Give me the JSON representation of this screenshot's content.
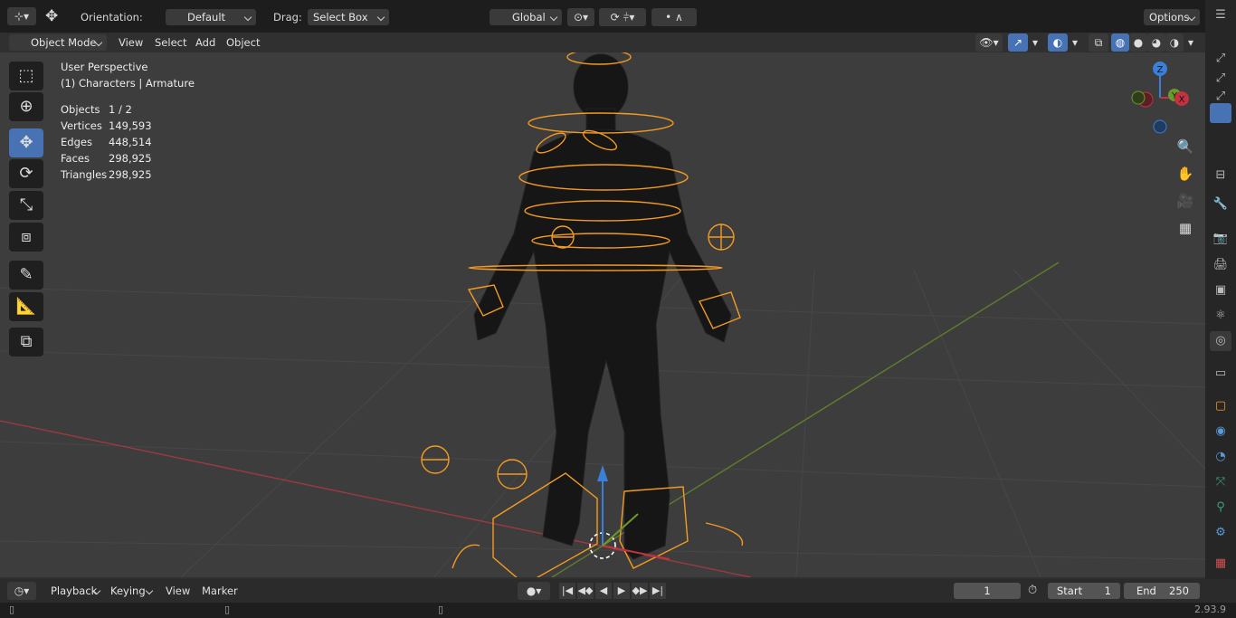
{
  "tool_header": {
    "orientation_label": "Orientation:",
    "orientation_value": "Default",
    "drag_label": "Drag:",
    "drag_value": "Select Box",
    "transform_orientation": "Global",
    "options_label": "Options"
  },
  "viewport_header": {
    "mode": "Object Mode",
    "menus": [
      "View",
      "Select",
      "Add",
      "Object"
    ]
  },
  "overlay": {
    "perspective": "User Perspective",
    "collection": "(1) Characters | Armature",
    "stats": [
      {
        "label": "Objects",
        "value": "1 / 2"
      },
      {
        "label": "Vertices",
        "value": "149,593"
      },
      {
        "label": "Edges",
        "value": "448,514"
      },
      {
        "label": "Faces",
        "value": "298,925"
      },
      {
        "label": "Triangles",
        "value": "298,925"
      }
    ]
  },
  "gizmo": {
    "z_label": "Z",
    "y_label": "Y",
    "x_label": "X"
  },
  "toolbar": {
    "tools": [
      {
        "name": "select-box-tool",
        "icon": "select-box-icon",
        "active": false
      },
      {
        "name": "cursor-tool",
        "icon": "cursor-icon",
        "active": false
      },
      {
        "name": "move-tool",
        "icon": "move-icon",
        "active": true
      },
      {
        "name": "rotate-tool",
        "icon": "rotate-icon",
        "active": false
      },
      {
        "name": "scale-tool",
        "icon": "scale-icon",
        "active": false
      },
      {
        "name": "transform-tool",
        "icon": "transform-icon",
        "active": false
      },
      {
        "name": "annotate-tool",
        "icon": "annotate-icon",
        "active": false
      },
      {
        "name": "measure-tool",
        "icon": "measure-icon",
        "active": false
      },
      {
        "name": "add-cube-tool",
        "icon": "add-cube-icon",
        "active": false
      }
    ]
  },
  "timeline": {
    "editor_menus": [
      "Playback",
      "Keying",
      "View",
      "Marker"
    ],
    "current_frame": "1",
    "start_label": "Start",
    "start_value": "1",
    "end_label": "End",
    "end_value": "250"
  },
  "status_bar": {
    "version": "2.93.9"
  },
  "colors": {
    "accent": "#4772b3",
    "armature": "#f39a22",
    "axis_x": "#c0333f",
    "axis_y": "#6b9a2a",
    "axis_z": "#3a7fd8"
  }
}
